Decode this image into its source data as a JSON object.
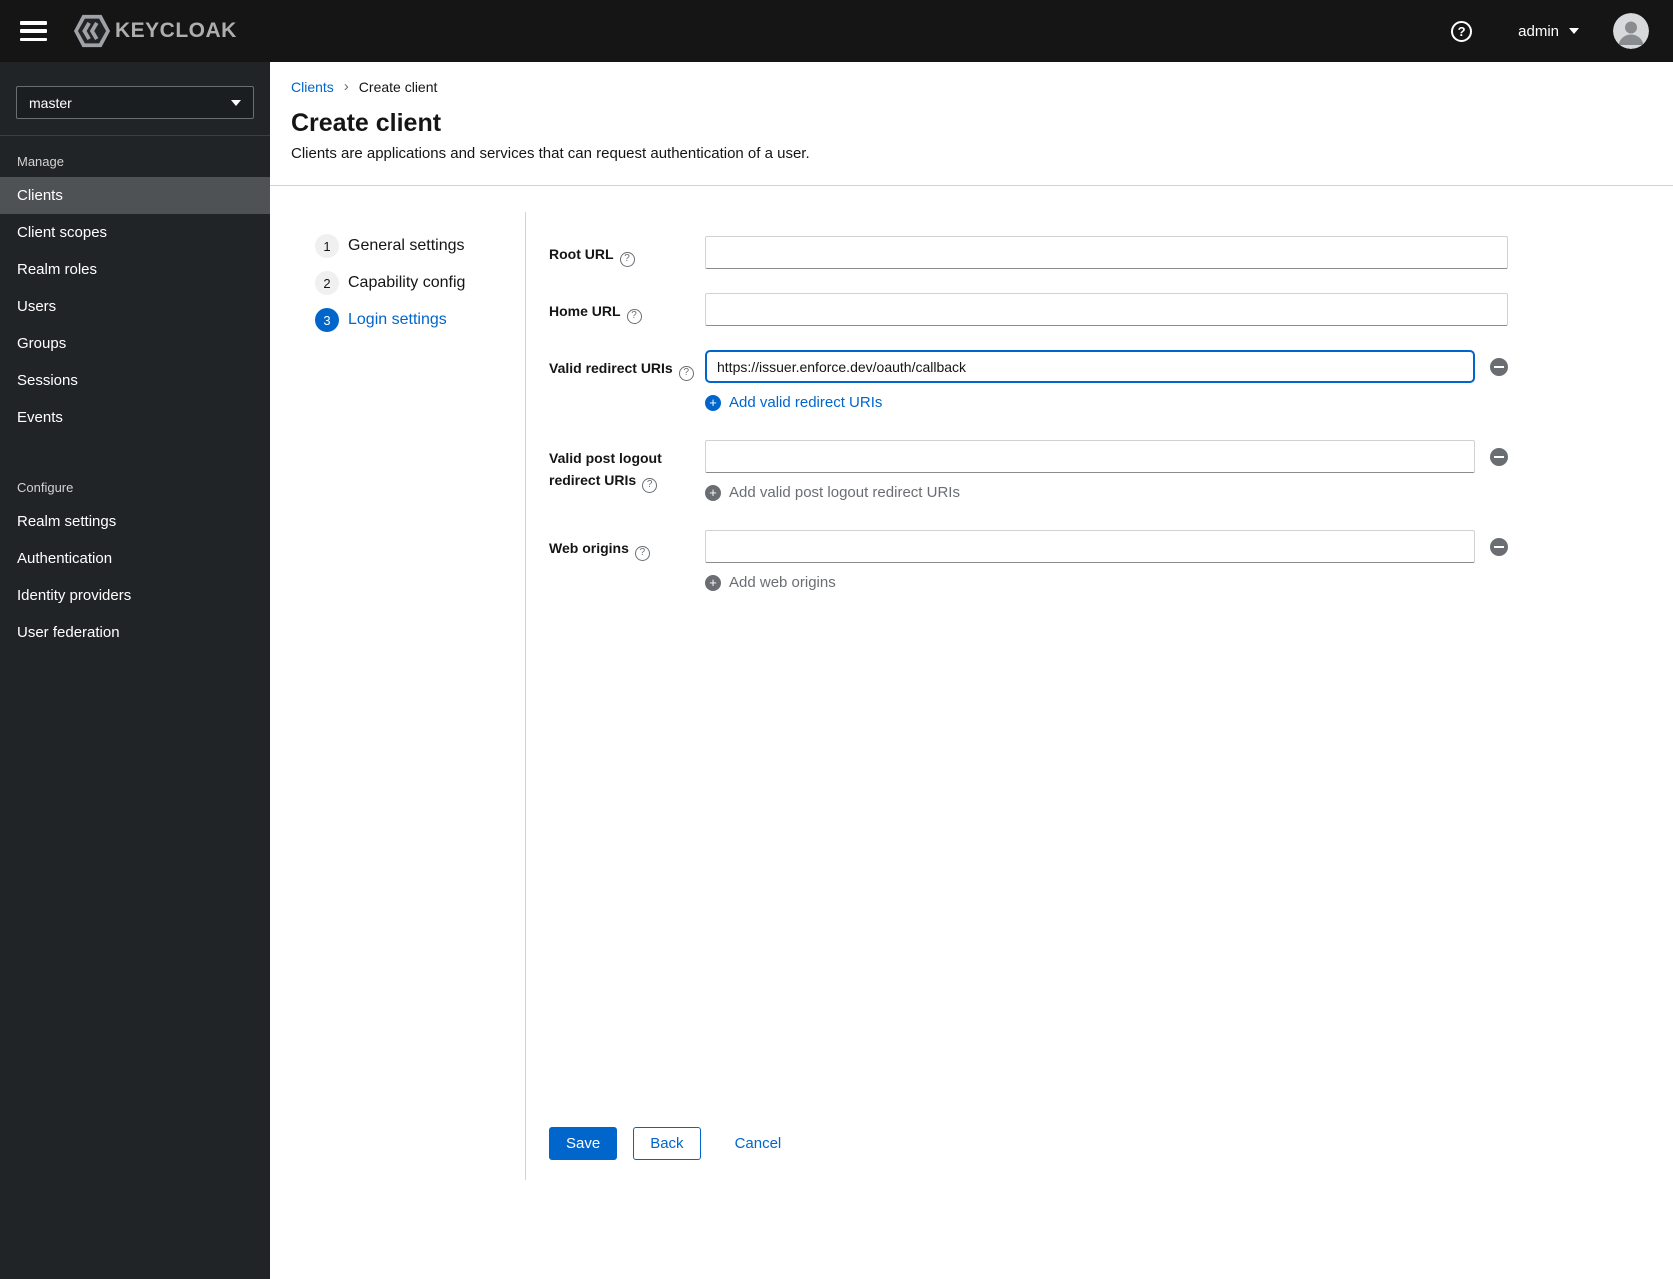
{
  "topbar": {
    "brand": "KEYCLOAK",
    "username": "admin"
  },
  "sidebar": {
    "realm": "master",
    "sections": [
      {
        "label": "Manage",
        "items": [
          {
            "label": "Clients",
            "active": true
          },
          {
            "label": "Client scopes"
          },
          {
            "label": "Realm roles"
          },
          {
            "label": "Users"
          },
          {
            "label": "Groups"
          },
          {
            "label": "Sessions"
          },
          {
            "label": "Events"
          }
        ]
      },
      {
        "label": "Configure",
        "items": [
          {
            "label": "Realm settings"
          },
          {
            "label": "Authentication"
          },
          {
            "label": "Identity providers"
          },
          {
            "label": "User federation"
          }
        ]
      }
    ]
  },
  "breadcrumb": {
    "parent": "Clients",
    "separator": "›",
    "current": "Create client"
  },
  "page": {
    "title": "Create client",
    "subtitle": "Clients are applications and services that can request authentication of a user."
  },
  "wizard": {
    "steps": [
      {
        "number": "1",
        "label": "General settings",
        "state": "inactive"
      },
      {
        "number": "2",
        "label": "Capability config",
        "state": "inactive"
      },
      {
        "number": "3",
        "label": "Login settings",
        "state": "current"
      }
    ]
  },
  "form": {
    "root_url": {
      "label": "Root URL",
      "value": ""
    },
    "home_url": {
      "label": "Home URL",
      "value": ""
    },
    "valid_redirect_uris": {
      "label": "Valid redirect URIs",
      "value": "https://issuer.enforce.dev/oauth/callback",
      "add_label": "Add valid redirect URIs",
      "add_enabled": true
    },
    "post_logout_redirect_uris": {
      "label": "Valid post logout redirect URIs",
      "value": "",
      "add_label": "Add valid post logout redirect URIs",
      "add_enabled": false
    },
    "web_origins": {
      "label": "Web origins",
      "value": "",
      "add_label": "Add web origins",
      "add_enabled": false
    }
  },
  "actions": {
    "save": "Save",
    "back": "Back",
    "cancel": "Cancel"
  },
  "colors": {
    "accent_blue": "#0066cc",
    "topbar_bg": "#151515",
    "sidebar_bg": "#212427",
    "sidebar_selected_bg": "#4f5255",
    "muted_text": "#6a6e73",
    "divider": "#d2d2d2"
  }
}
